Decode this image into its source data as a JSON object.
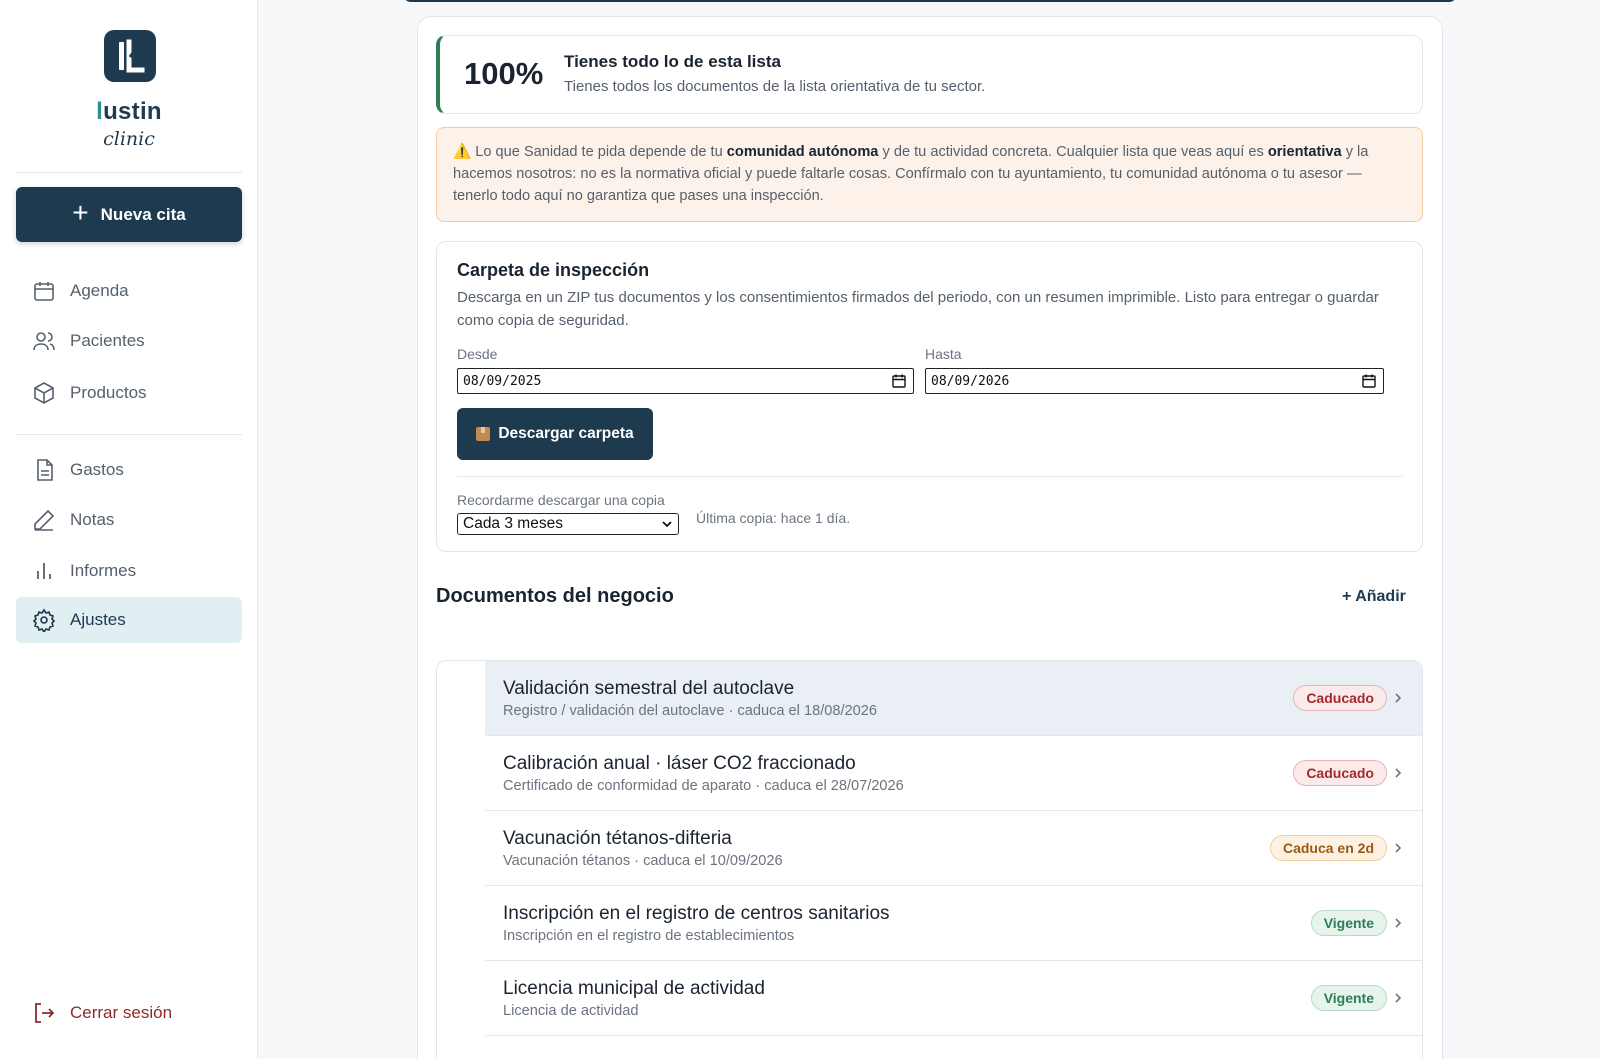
{
  "sidebar": {
    "brand_accent": "l",
    "brand_rest": "ustin",
    "brand_sub": "clinic",
    "new_button": "Nueva cita",
    "nav": [
      {
        "label": "Agenda",
        "icon": "calendar-icon"
      },
      {
        "label": "Pacientes",
        "icon": "users-icon"
      },
      {
        "label": "Productos",
        "icon": "box-icon"
      },
      {
        "label": "Gastos",
        "icon": "document-icon"
      },
      {
        "label": "Notas",
        "icon": "pencil-icon"
      },
      {
        "label": "Informes",
        "icon": "bar-chart-icon"
      },
      {
        "label": "Ajustes",
        "icon": "gear-icon",
        "active": true
      }
    ],
    "logout": "Cerrar sesión"
  },
  "progress": {
    "percent": "100%",
    "title": "Tienes todo lo de esta lista",
    "subtitle": "Tienes todos los documentos de la lista orientativa de tu sector."
  },
  "warning": {
    "part1": " Lo que Sanidad te pida depende de tu ",
    "bold1": "comunidad autónoma",
    "part2": " y de tu actividad concreta. Cualquier lista que veas aquí es ",
    "bold2": "orientativa",
    "part3": " y la hacemos nosotros: no es la normativa oficial y puede faltarle cosas. Confírmalo con tu ayuntamiento, tu comunidad autónoma o tu asesor — tenerlo todo aquí no garantiza que pases una inspección."
  },
  "folder": {
    "title": "Carpeta de inspección",
    "description": "Descarga en un ZIP tus documentos y los consentimientos firmados del periodo, con un resumen imprimible. Listo para entregar o guardar como copia de seguridad.",
    "from_label": "Desde",
    "from_value": "08/09/2025",
    "to_label": "Hasta",
    "to_value": "08/09/2026",
    "download_button": "Descargar carpeta",
    "remind_label": "Recordarme descargar una copia",
    "remind_value": "Cada 3 meses",
    "last_copy": "Última copia: hace 1 día."
  },
  "documents": {
    "title": "Documentos del negocio",
    "add_label": "+ Añadir",
    "items": [
      {
        "name": "Validación semestral del autoclave",
        "meta": "Registro / validación del autoclave · caduca el 18/08/2026",
        "status": "Caducado"
      },
      {
        "name": "Calibración anual · láser CO2 fraccionado",
        "meta": "Certificado de conformidad de aparato · caduca el 28/07/2026",
        "status": "Caducado"
      },
      {
        "name": "Vacunación tétanos-difteria",
        "meta": "Vacunación tétanos · caduca el 10/09/2026",
        "status": "Caduca en 2d"
      },
      {
        "name": "Inscripción en el registro de centros sanitarios",
        "meta": "Inscripción en el registro de establecimientos",
        "status": "Vigente"
      },
      {
        "name": "Licencia municipal de actividad",
        "meta": "Licencia de actividad",
        "status": "Vigente"
      }
    ]
  },
  "colors": {
    "primary": "#1e3a4f",
    "success": "#2f7d54",
    "danger": "#a52a2a",
    "warning_bg": "#fdf2e9"
  }
}
